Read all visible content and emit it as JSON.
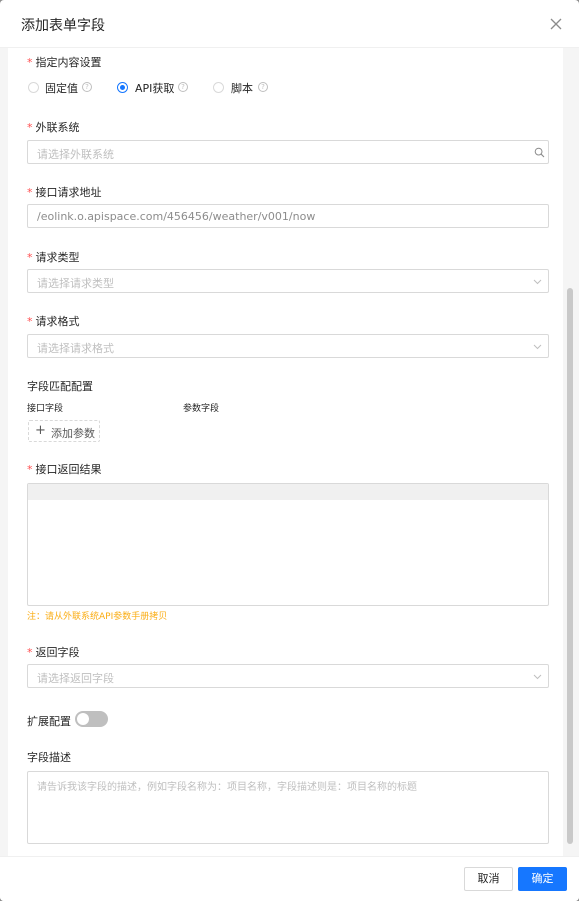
{
  "modal": {
    "title": "添加表单字段",
    "close_icon": "close-icon"
  },
  "form": {
    "content_setting": {
      "label": "指定内容设置",
      "required_mark": "*",
      "options": [
        {
          "label": "固定值",
          "checked": false
        },
        {
          "label": "API获取",
          "checked": true
        },
        {
          "label": "脚本",
          "checked": false
        }
      ],
      "help_glyph": "?"
    },
    "external_system": {
      "label": "外联系统",
      "required_mark": "*",
      "placeholder": "请选择外联系统",
      "icon": "search-icon"
    },
    "api_url": {
      "label": "接口请求地址",
      "required_mark": "*",
      "value": "/eolink.o.apispace.com/456456/weather/v001/now"
    },
    "request_type": {
      "label": "请求类型",
      "required_mark": "*",
      "placeholder": "请选择请求类型",
      "icon": "chevron-down-icon"
    },
    "request_format": {
      "label": "请求格式",
      "required_mark": "*",
      "placeholder": "请选择请求格式",
      "icon": "chevron-down-icon"
    },
    "field_mapping": {
      "label": "字段匹配配置",
      "col_interface": "接口字段",
      "col_param": "参数字段",
      "add_button": "添加参数",
      "add_glyph": "+"
    },
    "api_result": {
      "label": "接口返回结果",
      "required_mark": "*",
      "note": "注：请从外联系统API参数手册拷贝"
    },
    "return_field": {
      "label": "返回字段",
      "required_mark": "*",
      "placeholder": "请选择返回字段",
      "icon": "chevron-down-icon"
    },
    "extension": {
      "label": "扩展配置",
      "enabled": false
    },
    "description": {
      "label": "字段描述",
      "placeholder": "请告诉我该字段的描述，例如字段名称为：项目名称，字段描述则是：项目名称的标题"
    }
  },
  "footer": {
    "cancel_label": "取消",
    "ok_label": "确定"
  },
  "colors": {
    "primary": "#1677ff",
    "required": "#ff4d4f",
    "note": "#faad14"
  }
}
